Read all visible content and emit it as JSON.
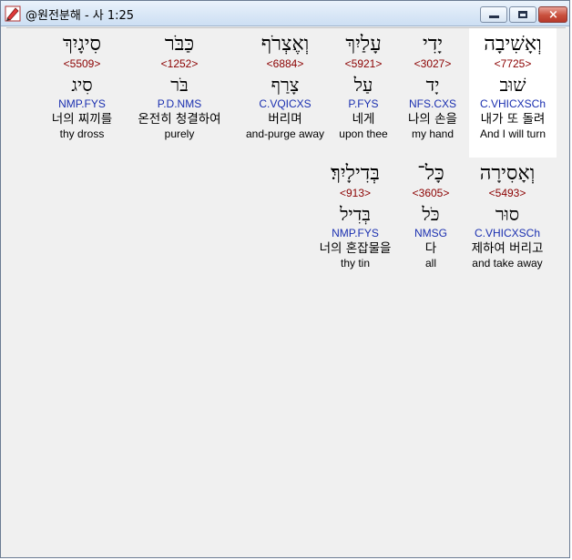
{
  "window": {
    "title": "@원전분해 - 사 1:25",
    "icon": "app-icon",
    "buttons": {
      "minimize": "minimize-icon",
      "maximize": "maximize-icon",
      "close": "×"
    }
  },
  "words": [
    {
      "hebrew": "וְאָשִׁיבָה",
      "strong": "<7725>",
      "root": "שׁוּב",
      "morph": "C.VHICXSCh",
      "korean": "내가 또 돌려",
      "english": "And I will turn",
      "selected": true
    },
    {
      "hebrew": "יָדִי",
      "strong": "<3027>",
      "root": "יָד",
      "morph": "NFS.CXS",
      "korean": "나의 손을",
      "english": "my hand",
      "selected": false
    },
    {
      "hebrew": "עָלַיִךְ",
      "strong": "<5921>",
      "root": "עַל",
      "morph": "P.FYS",
      "korean": "네게",
      "english": "upon thee",
      "selected": false
    },
    {
      "hebrew": "וְאֶצְרֹף",
      "strong": "<6884>",
      "root": "צָרַף",
      "morph": "C.VQICXS",
      "korean": "버리며",
      "english": "and-purge away",
      "selected": false
    },
    {
      "hebrew": "כַּבֹּר",
      "strong": "<1252>",
      "root": "בֹּר",
      "morph": "P.D.NMS",
      "korean": "온전히 청결하여",
      "english": "purely",
      "selected": false
    },
    {
      "hebrew": "סִיגָיִךְ",
      "strong": "<5509>",
      "root": "סִיג",
      "morph": "NMP.FYS",
      "korean": "너의 찌끼를",
      "english": "thy dross",
      "selected": false
    },
    {
      "hebrew": "וְאָסִירָה",
      "strong": "<5493>",
      "root": "סוּר",
      "morph": "C.VHICXSCh",
      "korean": "제하여 버리고",
      "english": "and take away",
      "selected": false
    },
    {
      "hebrew": "כָּל־",
      "strong": "<3605>",
      "root": "כֹּל",
      "morph": "NMSG",
      "korean": "다",
      "english": "all",
      "selected": false
    },
    {
      "hebrew": "בְּדִילָיִךְ׃",
      "strong": "<913>",
      "root": "בְּדִיל",
      "morph": "NMP.FYS",
      "korean": "너의 혼잡물을",
      "english": "thy tin",
      "selected": false
    }
  ]
}
